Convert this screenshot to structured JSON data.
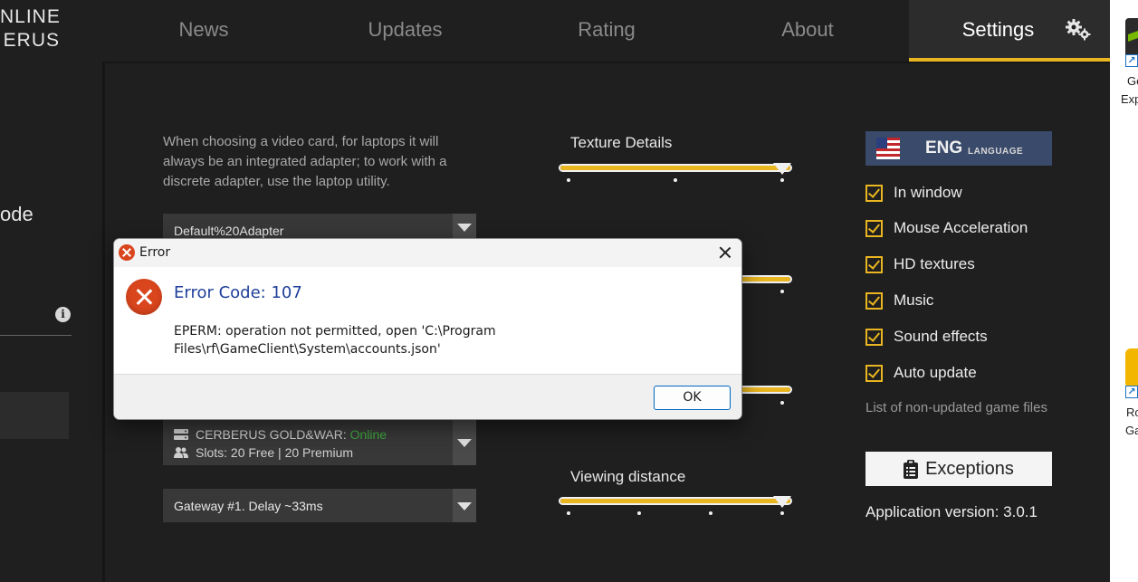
{
  "app": {
    "logo_line1": "NLINE",
    "logo_line2": "ERUS"
  },
  "nav": {
    "tabs": [
      {
        "label": "News"
      },
      {
        "label": "Updates"
      },
      {
        "label": "Rating"
      },
      {
        "label": "About"
      },
      {
        "label": "Settings",
        "active": true
      }
    ],
    "accent_color": "#e9b520"
  },
  "left_panel": {
    "partial_text": "ode"
  },
  "settings": {
    "hint": "When choosing a video card, for laptops it will always be an integrated adapter; to work with a discrete adapter, use the laptop utility.",
    "adapter_select": "Default%20Adapter",
    "server_select": {
      "name": "CERBERUS GOLD&WAR:",
      "status": "Online",
      "slots": "Slots: 20 Free | 20 Premium"
    },
    "gateway_select": "Gateway #1. Delay ~33ms",
    "sliders": [
      {
        "title": "Texture Details",
        "level": 1.0
      },
      {
        "title": "",
        "level": 1.0
      },
      {
        "title": "",
        "level": 1.0
      },
      {
        "title": "Viewing distance",
        "level": 1.0
      }
    ],
    "language": {
      "code": "ENG",
      "label": "LANGUAGE"
    },
    "checkboxes": [
      {
        "label": "In window",
        "checked": true
      },
      {
        "label": "Mouse Acceleration",
        "checked": true
      },
      {
        "label": "HD textures",
        "checked": true
      },
      {
        "label": "Music",
        "checked": true
      },
      {
        "label": "Sound effects",
        "checked": true
      },
      {
        "label": "Auto update",
        "checked": true
      }
    ],
    "non_updated_label": "List of non-updated game files",
    "exceptions_label": "Exceptions",
    "app_version": "Application version: 3.0.1"
  },
  "desktop": {
    "icon1_label_line1": "Ge",
    "icon1_label_line2": "Exp",
    "icon2_label_line1": "Ro",
    "icon2_label_line2": "Ga"
  },
  "dialog": {
    "title": "Error",
    "heading": "Error Code: 107",
    "message": "EPERM: operation not permitted, open 'C:\\Program Files\\rf\\GameClient\\System\\accounts.json'",
    "ok_label": "OK"
  }
}
